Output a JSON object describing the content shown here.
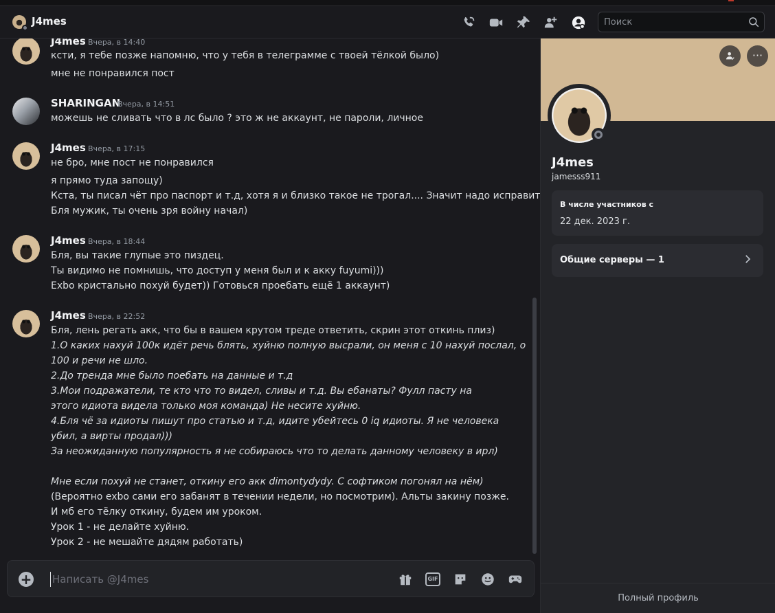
{
  "header": {
    "title": "J4mes",
    "search_placeholder": "Поиск",
    "icons": [
      "voice-call-icon",
      "video-call-icon",
      "pin-icon",
      "add-friends-icon",
      "user-profile-icon",
      "search-icon"
    ]
  },
  "messages": [
    {
      "author": "J4mes",
      "time": "Вчера, в 14:40",
      "avatar": "pug",
      "lines": [
        "ксти, я тебе позже напомню, что у тебя в телеграмме с твоей тёлкой было)",
        "мне не понравился пост"
      ]
    },
    {
      "author": "SHARINGAN",
      "time": "Вчера, в 14:51",
      "avatar": "sharingan",
      "lines": [
        "можешь не сливать что в лс было ? это ж не аккаунт, не пароли, личное"
      ]
    },
    {
      "author": "J4mes",
      "time": "Вчера, в 17:15",
      "avatar": "pug",
      "lines": [
        "не бро, мне пост не понравился",
        "я прямо туда запощу)",
        "Кста, ты писал чёт про паспорт и т.д, хотя я и близко такое не трогал.... Значит надо исправить)",
        "Бля мужик, ты очень зря войну начал)"
      ]
    },
    {
      "author": "J4mes",
      "time": "Вчера, в 18:44",
      "avatar": "pug",
      "lines": [
        "Бля, вы такие глупые это пиздец.",
        "Ты видимо не помнишь, что доступ у меня был и к акку fuyumi)))",
        "Exbo кристально похуй будет)) Готовься проебать ещё 1 аккаунт)"
      ]
    },
    {
      "author": "J4mes",
      "time": "Вчера, в 22:52",
      "avatar": "pug",
      "lines": [
        "Бля, лень регать акк, что бы в вашем крутом треде ответить, скрин этот откинь плиз)",
        "1.О каких нахуй 100к идёт речь блять, хуйню полную высрали, он меня с 10 нахуй послал, о",
        "100 и речи не шло.",
        "2.До тренда мне было поебать на данные и т.д",
        "3.Мои подражатели, те кто что то видел, сливы и т.д. Вы ебанаты?  Фулл пасту на",
        "этого идиота видела только моя команда) Не несите хуйню.",
        "4.Бля чё за идиоты пишут про статью и т.д, идите убейтесь 0 iq идиоты. Я не человека",
        "убил, а вирты продал)))",
        "За неожиданную популярность я не собираюсь что то делать данному человеку в ирл)",
        "",
        "Мне если похуй не станет, откину его акк dimontydydy. С софтиком погонял на нём)",
        "(Вероятно exbo сами его забанят в течении недели, но посмотрим). Альты закину позже.",
        "И мб его тёлку откину, будем им уроком.",
        "Урок 1 - не делайте хуйню.",
        "Урок 2 - не мешайте дядям работать)"
      ]
    }
  ],
  "composer": {
    "placeholder": "Написать @J4mes",
    "icons": [
      "add-icon",
      "gift-icon",
      "gif-icon",
      "sticker-icon",
      "emoji-icon",
      "activities-icon"
    ],
    "gif_label": "GIF"
  },
  "profile": {
    "display_name": "J4mes",
    "username": "jamesss911",
    "member_since_label": "В числе участников с",
    "member_since_value": "22 дек. 2023 г.",
    "mutual_servers": "Общие серверы — 1",
    "full_profile": "Полный профиль",
    "more_symbol": "···",
    "banner_color": "#d1b894"
  }
}
